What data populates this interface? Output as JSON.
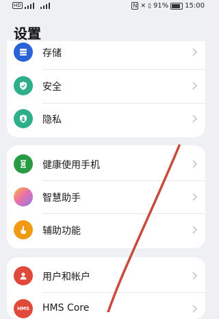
{
  "status_bar": {
    "left": "HD",
    "battery": "91%",
    "time": "15:00"
  },
  "page": {
    "title": "设置"
  },
  "card1": {
    "items": [
      {
        "label": "存储",
        "icon": "storage-icon",
        "color": "#2a63d6"
      },
      {
        "label": "安全",
        "icon": "shield-icon",
        "color": "#2fae8c"
      },
      {
        "label": "隐私",
        "icon": "privacy-icon",
        "color": "#2fae8c"
      }
    ]
  },
  "card2": {
    "items": [
      {
        "label": "健康使用手机",
        "icon": "hourglass-icon",
        "color": "#2a9b45"
      },
      {
        "label": "智慧助手",
        "icon": "assistant-orb-icon",
        "color": "#e86fa6"
      },
      {
        "label": "辅助功能",
        "icon": "hand-icon",
        "color": "#f09a14"
      }
    ]
  },
  "card3": {
    "items": [
      {
        "label": "用户和帐户",
        "icon": "user-icon",
        "color": "#e04a3a"
      },
      {
        "label": "HMS Core",
        "icon": "hms-icon",
        "color": "#e04a3a",
        "icon_text": "HMS"
      }
    ]
  },
  "annotation": {
    "color": "#c84a3c"
  }
}
